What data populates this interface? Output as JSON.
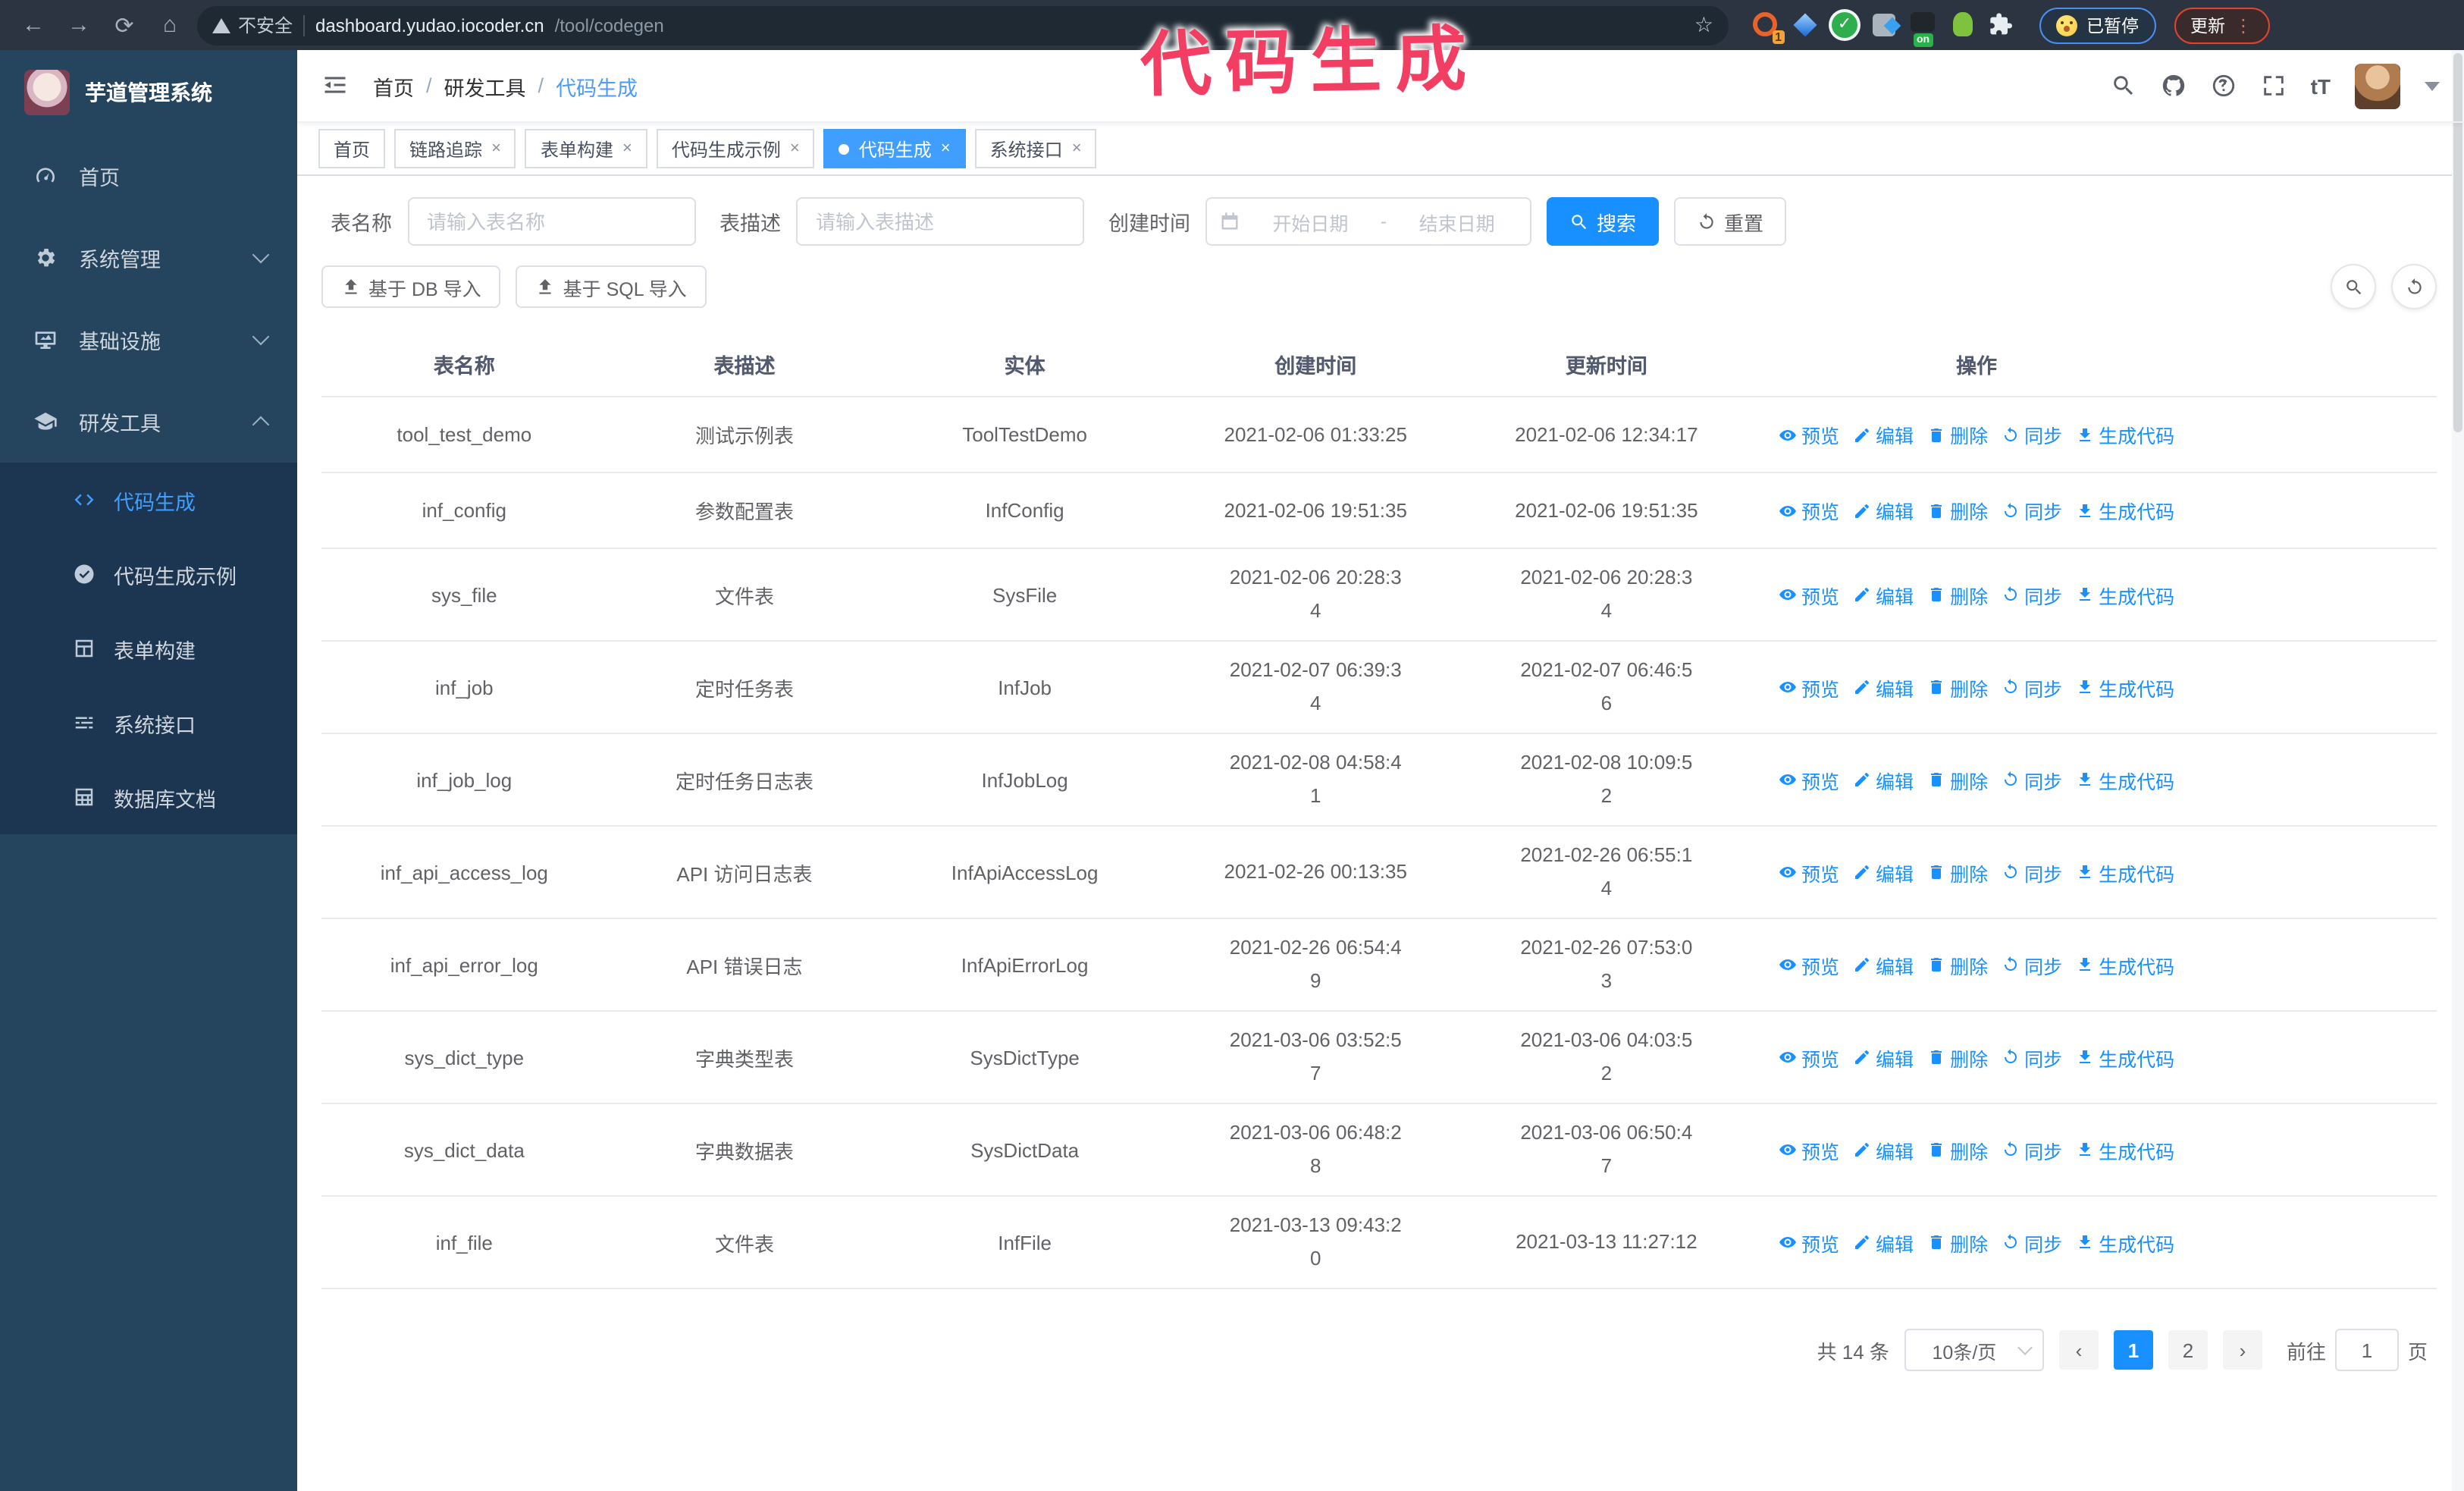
{
  "browser": {
    "security_label": "不安全",
    "url_host": "dashboard.yudao.iocoder.cn",
    "url_path": "/tool/codegen",
    "extension_badge": "1",
    "extension_on_badge": "on",
    "paused_badge": "已暂停",
    "update_button": "更新",
    "menu_dots": "⋮",
    "star": "☆"
  },
  "annotation": {
    "text": "代码生成",
    "color": "#f23e62"
  },
  "icons": {
    "close": "×",
    "breadcrumb_separator": "/",
    "back": "←",
    "forward": "→",
    "reload": "⟳",
    "home": "⌂"
  },
  "sidebar": {
    "title": "芋道管理系统",
    "items": [
      {
        "label": "首页"
      },
      {
        "label": "系统管理"
      },
      {
        "label": "基础设施"
      },
      {
        "label": "研发工具"
      }
    ],
    "subitems": [
      {
        "label": "代码生成",
        "active": true
      },
      {
        "label": "代码生成示例"
      },
      {
        "label": "表单构建"
      },
      {
        "label": "系统接口"
      },
      {
        "label": "数据库文档"
      }
    ]
  },
  "header": {
    "breadcrumb": [
      "首页",
      "研发工具",
      "代码生成"
    ]
  },
  "tabs": [
    {
      "label": "首页"
    },
    {
      "label": "链路追踪"
    },
    {
      "label": "表单构建"
    },
    {
      "label": "代码生成示例"
    },
    {
      "label": "代码生成"
    },
    {
      "label": "系统接口"
    }
  ],
  "filters": {
    "name_label": "表名称",
    "name_placeholder": "请输入表名称",
    "desc_label": "表描述",
    "desc_placeholder": "请输入表描述",
    "time_label": "创建时间",
    "start_placeholder": "开始日期",
    "range_separator": "-",
    "end_placeholder": "结束日期",
    "search_label": "搜索",
    "reset_label": "重置"
  },
  "toolbar": {
    "import_db": "基于 DB 导入",
    "import_sql": "基于 SQL 导入"
  },
  "table": {
    "columns": [
      "表名称",
      "表描述",
      "实体",
      "创建时间",
      "更新时间",
      "操作"
    ],
    "actions": [
      "预览",
      "编辑",
      "删除",
      "同步",
      "生成代码"
    ],
    "rows": [
      {
        "name": "tool_test_demo",
        "desc": "测试示例表",
        "entity": "ToolTestDemo",
        "created": "2021-02-06 01:33:25",
        "updated": "2021-02-06 12:34:17"
      },
      {
        "name": "inf_config",
        "desc": "参数配置表",
        "entity": "InfConfig",
        "created": "2021-02-06 19:51:35",
        "updated": "2021-02-06 19:51:35"
      },
      {
        "name": "sys_file",
        "desc": "文件表",
        "entity": "SysFile",
        "created": "2021-02-06 20:28:3\n4",
        "updated": "2021-02-06 20:28:3\n4"
      },
      {
        "name": "inf_job",
        "desc": "定时任务表",
        "entity": "InfJob",
        "created": "2021-02-07 06:39:3\n4",
        "updated": "2021-02-07 06:46:5\n6"
      },
      {
        "name": "inf_job_log",
        "desc": "定时任务日志表",
        "entity": "InfJobLog",
        "created": "2021-02-08 04:58:4\n1",
        "updated": "2021-02-08 10:09:5\n2"
      },
      {
        "name": "inf_api_access_log",
        "desc": "API 访问日志表",
        "entity": "InfApiAccessLog",
        "created": "2021-02-26 00:13:35",
        "updated": "2021-02-26 06:55:1\n4"
      },
      {
        "name": "inf_api_error_log",
        "desc": "API 错误日志",
        "entity": "InfApiErrorLog",
        "created": "2021-02-26 06:54:4\n9",
        "updated": "2021-02-26 07:53:0\n3"
      },
      {
        "name": "sys_dict_type",
        "desc": "字典类型表",
        "entity": "SysDictType",
        "created": "2021-03-06 03:52:5\n7",
        "updated": "2021-03-06 04:03:5\n2"
      },
      {
        "name": "sys_dict_data",
        "desc": "字典数据表",
        "entity": "SysDictData",
        "created": "2021-03-06 06:48:2\n8",
        "updated": "2021-03-06 06:50:4\n7"
      },
      {
        "name": "inf_file",
        "desc": "文件表",
        "entity": "InfFile",
        "created": "2021-03-13 09:43:2\n0",
        "updated": "2021-03-13 11:27:12"
      }
    ]
  },
  "pagination": {
    "total": "共 14 条",
    "page_size": "10条/页",
    "pages": [
      "1",
      "2"
    ],
    "active_page": "1",
    "goto_label": "前往",
    "goto_value": "1",
    "goto_suffix": "页"
  },
  "colors": {
    "accent_blue": "#1890ff",
    "active_tab_blue": "#409eff",
    "sidebar_bg": "#25455f",
    "submenu_bg": "#1c3550",
    "annotation_pink": "#f23e62"
  }
}
